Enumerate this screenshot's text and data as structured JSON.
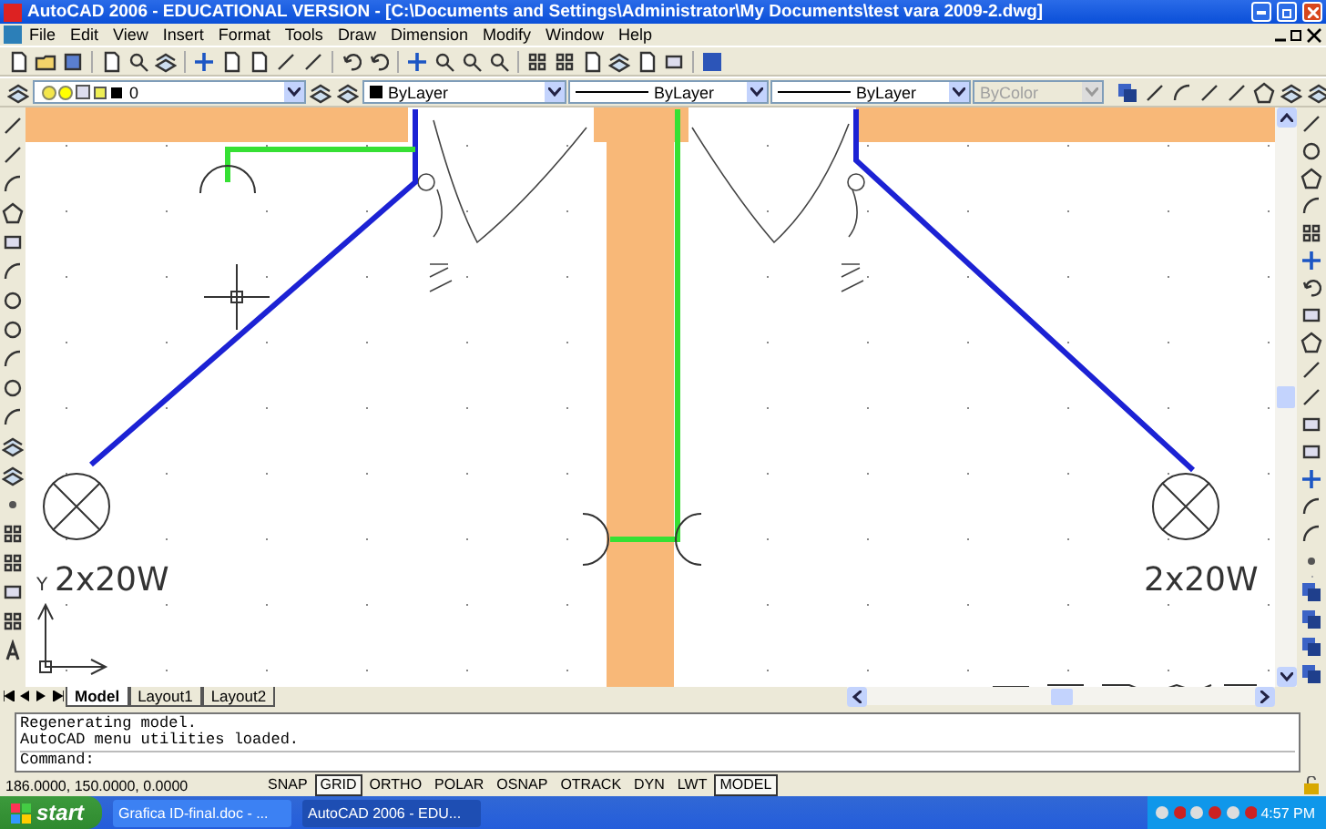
{
  "window": {
    "title": "AutoCAD 2006 - EDUCATIONAL VERSION - [C:\\Documents and Settings\\Administrator\\My Documents\\test vara 2009-2.dwg]"
  },
  "menu": [
    "File",
    "Edit",
    "View",
    "Insert",
    "Format",
    "Tools",
    "Draw",
    "Dimension",
    "Modify",
    "Window",
    "Help"
  ],
  "properties_toolbar": [
    {
      "kind": "layer",
      "value": "0",
      "disabled": false
    },
    {
      "kind": "color",
      "value": "ByLayer",
      "disabled": false
    },
    {
      "kind": "linetype",
      "value": "ByLayer",
      "disabled": false
    },
    {
      "kind": "lineweight",
      "value": "ByLayer",
      "disabled": false
    },
    {
      "kind": "plotstyle",
      "value": "ByColor",
      "disabled": true
    }
  ],
  "drawing": {
    "ucs_label": "Y",
    "lamp_labels": [
      "2x20W",
      "2x20W"
    ]
  },
  "layout_tabs": [
    {
      "label": "Model",
      "selected": true
    },
    {
      "label": "Layout1",
      "selected": false
    },
    {
      "label": "Layout2",
      "selected": false
    }
  ],
  "command_history": [
    "Regenerating model.",
    "AutoCAD menu utilities loaded."
  ],
  "command_prompt": "Command:",
  "status_bar": {
    "coordinates": "186.0000, 150.0000, 0.0000",
    "toggles": [
      {
        "label": "SNAP",
        "on": false
      },
      {
        "label": "GRID",
        "on": true
      },
      {
        "label": "ORTHO",
        "on": false
      },
      {
        "label": "POLAR",
        "on": false
      },
      {
        "label": "OSNAP",
        "on": false
      },
      {
        "label": "OTRACK",
        "on": false
      },
      {
        "label": "DYN",
        "on": false
      },
      {
        "label": "LWT",
        "on": false
      },
      {
        "label": "MODEL",
        "on": true
      }
    ]
  },
  "taskbar": {
    "start": "start",
    "tasks": [
      {
        "label": "Grafica ID-final.doc - ...",
        "selected": false
      },
      {
        "label": "AutoCAD 2006 - EDU...",
        "selected": true
      }
    ],
    "clock": "4:57 PM"
  }
}
